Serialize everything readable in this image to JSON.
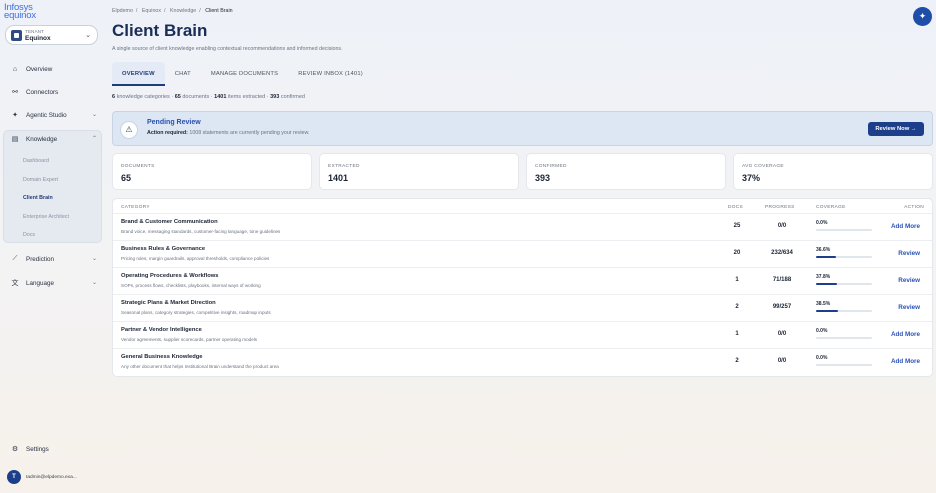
{
  "app": {
    "logo_line1": "Infosys",
    "logo_line2": "equinox"
  },
  "tenant": {
    "caption": "TENANT",
    "value": "Equinox"
  },
  "sidebar": {
    "items": [
      {
        "label": "Overview",
        "icon": "home-icon"
      },
      {
        "label": "Connectors",
        "icon": "plug-icon"
      },
      {
        "label": "Agentic Studio",
        "icon": "sparkle-icon"
      },
      {
        "label": "Knowledge",
        "icon": "book-icon"
      },
      {
        "label": "Prediction",
        "icon": "chart-icon"
      },
      {
        "label": "Language",
        "icon": "translate-icon"
      }
    ],
    "knowledge_sub": [
      "Dashboard",
      "Domain Expert",
      "Client Brain",
      "Enterprise Architect",
      "Docs"
    ],
    "settings": "Settings",
    "user": {
      "initial": "T",
      "email": "tadmin@elpdemo.exa..."
    }
  },
  "breadcrumb": [
    "Elpdemo",
    "Equinox",
    "Knowledge",
    "Client Brain"
  ],
  "page": {
    "title": "Client Brain",
    "subtitle": "A single source of client knowledge enabling contextual recommendations and informed decisions."
  },
  "tabs": [
    "OVERVIEW",
    "CHAT",
    "MANAGE DOCUMENTS",
    "REVIEW INBOX (1401)"
  ],
  "summary": {
    "cats": "6",
    "cats_text": " knowledge categories · ",
    "docs": "65",
    "docs_text": " documents · ",
    "items": "1401",
    "items_text": " items extracted · ",
    "confirmed": "393",
    "confirmed_text": " confirmed"
  },
  "alert": {
    "title": "Pending Review",
    "bold": "Action required:",
    "text": " 1008 statements are currently pending your review.",
    "button": "Review Now →"
  },
  "stats": [
    {
      "label": "DOCUMENTS",
      "value": "65"
    },
    {
      "label": "EXTRACTED",
      "value": "1401"
    },
    {
      "label": "CONFIRMED",
      "value": "393"
    },
    {
      "label": "AVG COVERAGE",
      "value": "37%"
    }
  ],
  "table": {
    "headers": {
      "category": "CATEGORY",
      "docs": "DOCS",
      "progress": "PROGRESS",
      "coverage": "COVERAGE",
      "action": "ACTION"
    },
    "rows": [
      {
        "name": "Brand & Customer Communication",
        "desc": "Brand voice, messaging standards, customer-facing language, tone guidelines",
        "docs": "25",
        "progress": "0/0",
        "coverage": "0.0%",
        "fill": 0.0,
        "action": "Add More"
      },
      {
        "name": "Business Rules & Governance",
        "desc": "Pricing rules, margin guardrails, approval thresholds, compliance policies",
        "docs": "20",
        "progress": "232/634",
        "coverage": "36.6%",
        "fill": 0.366,
        "action": "Review"
      },
      {
        "name": "Operating Procedures & Workflows",
        "desc": "SOPs, process flows, checklists, playbooks, internal ways of working",
        "docs": "1",
        "progress": "71/188",
        "coverage": "37.8%",
        "fill": 0.378,
        "action": "Review"
      },
      {
        "name": "Strategic Plans & Market Direction",
        "desc": "Seasonal plans, category strategies, competitive insights, roadmap inputs",
        "docs": "2",
        "progress": "99/257",
        "coverage": "38.5%",
        "fill": 0.385,
        "action": "Review"
      },
      {
        "name": "Partner & Vendor Intelligence",
        "desc": "Vendor agreements, supplier scorecards, partner operating models",
        "docs": "1",
        "progress": "0/0",
        "coverage": "0.0%",
        "fill": 0.0,
        "action": "Add More"
      },
      {
        "name": "General Business Knowledge",
        "desc": "Any other document that helps Institutional Brain understand the product area",
        "docs": "2",
        "progress": "0/0",
        "coverage": "0.0%",
        "fill": 0.0,
        "action": "Add More"
      }
    ]
  },
  "colors": {
    "primary": "#1d3e8a",
    "link": "#2a52b8",
    "alert_bg": "#dde6f3"
  }
}
